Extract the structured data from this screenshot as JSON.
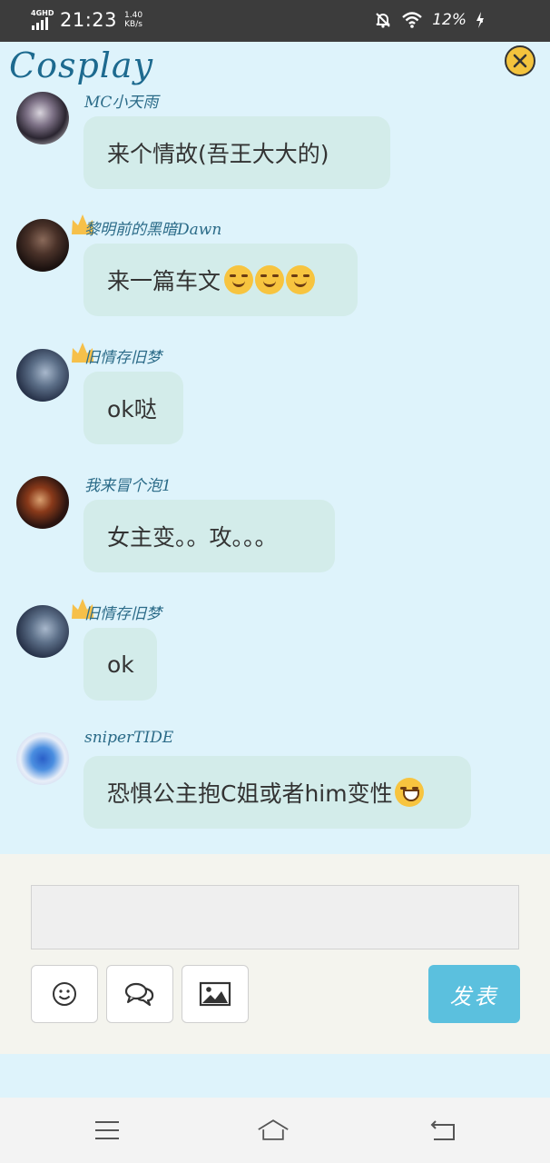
{
  "status_bar": {
    "network": "4GHD",
    "time": "21:23",
    "speed_value": "1.40",
    "speed_unit": "KB/s",
    "battery": "12%"
  },
  "header": {
    "title": "Cosplay",
    "close_icon": "close-icon"
  },
  "messages": [
    {
      "user": "MC小天雨",
      "text": "来个情故(吾王大大的)",
      "emoji": "",
      "crown": false
    },
    {
      "user": "黎明前的黑暗Dawn",
      "text": "来一篇车文",
      "emoji": "smirk-emoji x3",
      "crown": true
    },
    {
      "user": "旧情存旧梦",
      "text": "ok哒",
      "emoji": "",
      "crown": true
    },
    {
      "user": "我来冒个泡1",
      "text": "女主变。。攻。。。",
      "emoji": "",
      "crown": false
    },
    {
      "user": "旧情存旧梦",
      "text": "ok",
      "emoji": "",
      "crown": true
    },
    {
      "user": "sniperTIDE",
      "text": "恐惧公主抱C姐或者him变性",
      "emoji": "grin-emoji",
      "crown": false
    }
  ],
  "composer": {
    "input_value": "",
    "tools": [
      "emoji-icon",
      "chat-bubbles-icon",
      "image-icon"
    ],
    "send_label": "发表"
  },
  "colors": {
    "page_bg": "#def3fb",
    "bubble_bg": "#d3ecea",
    "send_bg": "#5bc0de",
    "username": "#2b6b88"
  }
}
